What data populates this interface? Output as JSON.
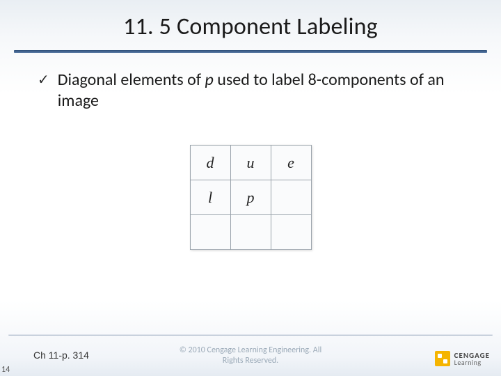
{
  "title": "11. 5 Component Labeling",
  "bullet": {
    "check": "✓",
    "pre": "Diagonal elements of ",
    "var": "p",
    "post": " used to label 8-components of an image"
  },
  "grid": {
    "r0c0": "d",
    "r0c1": "u",
    "r0c2": "e",
    "r1c0": "l",
    "r1c1": "p",
    "r1c2": "",
    "r2c0": "",
    "r2c1": "",
    "r2c2": ""
  },
  "footer": {
    "page_num": "14",
    "chapter_ref": "Ch 11-p. 314",
    "copyright": "© 2010 Cengage Learning Engineering. All\nRights Reserved.",
    "brand_line1": "CENGAGE",
    "brand_line2": "Learning"
  }
}
